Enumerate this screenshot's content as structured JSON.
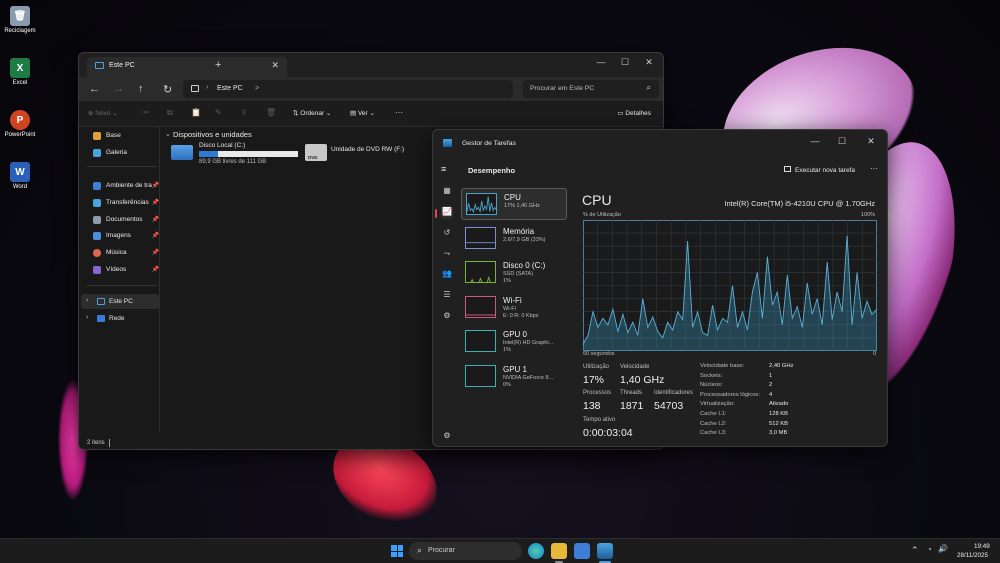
{
  "desktop": {
    "icons": [
      {
        "label": "Reciclagem",
        "icon": "recycle-bin-icon",
        "color": "#8a9bb0"
      },
      {
        "label": "Excel",
        "icon": "excel-icon",
        "color": "#1d7b46"
      },
      {
        "label": "PowerPoint",
        "icon": "powerpoint-icon",
        "color": "#d04423"
      },
      {
        "label": "Word",
        "icon": "word-icon",
        "color": "#2b5fb8"
      }
    ]
  },
  "explorer": {
    "tab_title": "Este PC",
    "new_tab": "+",
    "breadcrumb": [
      "Este PC",
      ">"
    ],
    "search_placeholder": "Procurar em Este PC",
    "toolbar": {
      "new": "Novo",
      "sort": "Ordenar",
      "view": "Ver",
      "more": "···",
      "details": "Detalhes"
    },
    "sidebar": {
      "quick": [
        {
          "label": "Base"
        },
        {
          "label": "Galeria"
        }
      ],
      "pinned": [
        {
          "label": "Ambiente de tra",
          "color": "#3f7ed8"
        },
        {
          "label": "Transferências",
          "color": "#4aa3df"
        },
        {
          "label": "Documentos",
          "color": "#8e9bab"
        },
        {
          "label": "Imagens",
          "color": "#4a8fd8"
        },
        {
          "label": "Música",
          "color": "#e0664e"
        },
        {
          "label": "Vídeos",
          "color": "#8a63d2"
        }
      ],
      "tree": [
        {
          "label": "Este PC",
          "selected": true
        },
        {
          "label": "Rede",
          "selected": false
        }
      ]
    },
    "section_header": "Dispositivos e unidades",
    "drives": [
      {
        "name": "Disco Local (C:)",
        "free_text": "89,9 GB livres de 111 GB",
        "used_fraction": 0.19
      },
      {
        "name": "Unidade de DVD RW (F:)",
        "badge": "DVD"
      }
    ],
    "status": "2 itens"
  },
  "taskmgr": {
    "title": "Gestor de Tarefas",
    "page": "Desempenho",
    "run_task": "Executar nova tarefa",
    "more": "···",
    "cards": [
      {
        "title": "CPU",
        "sub": "17%  1,40 GHz",
        "sub2": "",
        "color": "#4aa3c8",
        "selected": true
      },
      {
        "title": "Memória",
        "sub": "2,6/7,9 GB (33%)",
        "sub2": "",
        "color": "#7b8fd6",
        "selected": false
      },
      {
        "title": "Disco 0 (C:)",
        "sub": "SSD (SATA)",
        "sub2": "1%",
        "color": "#7ab33a",
        "selected": false
      },
      {
        "title": "Wi-Fi",
        "sub": "Wi-Fi",
        "sub2": "E: 0  R: 0 Kbps",
        "color": "#c65a7a",
        "selected": false
      },
      {
        "title": "GPU 0",
        "sub": "Intel(R) HD Graphi...",
        "sub2": "1%",
        "color": "#3db0b0",
        "selected": false
      },
      {
        "title": "GPU 1",
        "sub": "NVIDIA GeForce 8...",
        "sub2": "0%",
        "color": "#3db0b0",
        "selected": false
      }
    ],
    "cpu": {
      "heading": "CPU",
      "model": "Intel(R) Core(TM) i5-4210U CPU @ 1.70GHz",
      "y_label": "% de Utilização",
      "y_max": "100%",
      "x_left": "60 segundos",
      "x_right": "0",
      "stats": {
        "util_label": "Utilização",
        "util": "17%",
        "speed_label": "Velocidade",
        "speed": "1,40 GHz",
        "proc_label": "Processos",
        "proc": "138",
        "threads_label": "Threads",
        "threads": "1871",
        "handles_label": "Identificadores",
        "handles": "54703",
        "uptime_label": "Tempo ativo",
        "uptime": "0:00:03:04"
      },
      "details": [
        {
          "k": "Velocidade base:",
          "v": "2,40 GHz"
        },
        {
          "k": "Sockets:",
          "v": "1"
        },
        {
          "k": "Núcleos:",
          "v": "2"
        },
        {
          "k": "Processadores lógicos:",
          "v": "4"
        },
        {
          "k": "Virtualização:",
          "v": "Ativado"
        },
        {
          "k": "Cache L1:",
          "v": "128 KB"
        },
        {
          "k": "Cache L2:",
          "v": "512 KB"
        },
        {
          "k": "Cache L3:",
          "v": "3,0 MB"
        }
      ]
    }
  },
  "chart_data": {
    "type": "area",
    "title": "CPU",
    "ylabel": "% de Utilização",
    "xlabel": "",
    "ylim": [
      0,
      100
    ],
    "x_range": [
      "60 segundos",
      "0"
    ],
    "series": [
      {
        "values": [
          5,
          12,
          30,
          18,
          25,
          20,
          32,
          15,
          28,
          14,
          22,
          12,
          40,
          18,
          26,
          15,
          10,
          22,
          16,
          30,
          24,
          84,
          18,
          30,
          14,
          12,
          35,
          16,
          25,
          22,
          50,
          18,
          30,
          16,
          45,
          60,
          25,
          72,
          35,
          45,
          20,
          58,
          25,
          34,
          18,
          52,
          28,
          40,
          20,
          68,
          24,
          45,
          30,
          88,
          20,
          60,
          25,
          38,
          28,
          32
        ]
      }
    ]
  },
  "taskbar": {
    "search": "Procurar",
    "time": "19:49",
    "date": "28/11/2025",
    "pins": [
      {
        "icon": "start-icon",
        "color": "#3aa0ff"
      },
      {
        "icon": "edge-icon",
        "color": "#2aa0c8"
      },
      {
        "icon": "folder-icon",
        "color": "#e8b938"
      },
      {
        "icon": "store-icon",
        "color": "#3f7ed8"
      },
      {
        "icon": "taskmgr-icon",
        "color": "#4aa3df"
      }
    ]
  }
}
